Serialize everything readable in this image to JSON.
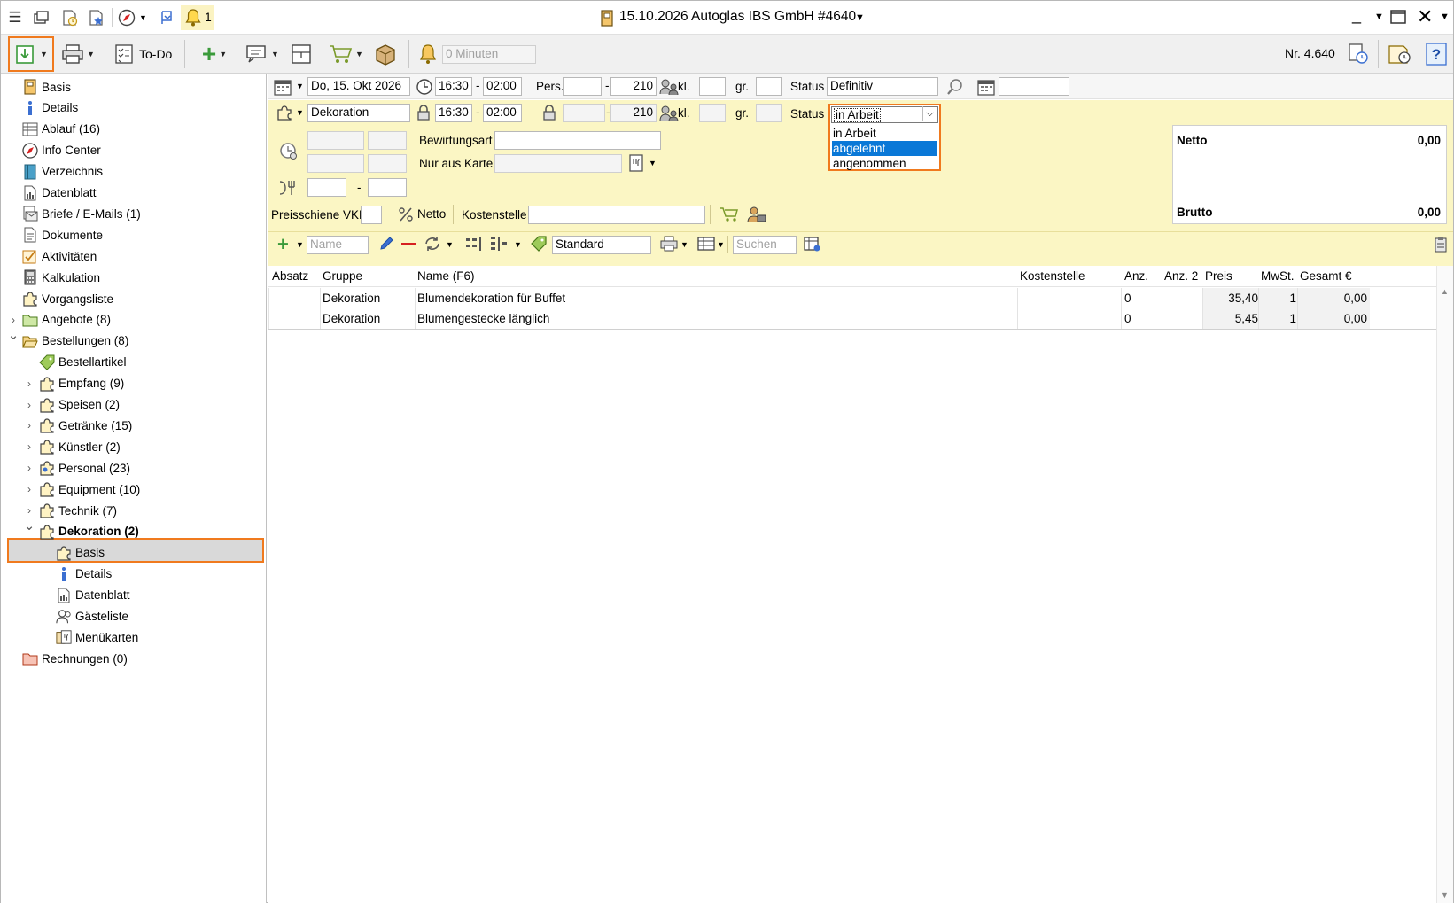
{
  "titlebar": {
    "title": "15.10.2026 Autoglas IBS GmbH  #4640",
    "notification_count": "1"
  },
  "toolbar": {
    "todo_label": "To-Do",
    "minutes_placeholder": "0 Minuten",
    "number": "Nr. 4.640"
  },
  "sidebar": {
    "items": [
      {
        "label": "Basis",
        "icon": "document-icon"
      },
      {
        "label": "Details",
        "icon": "info-icon"
      },
      {
        "label": "Ablauf (16)",
        "icon": "schedule-icon"
      },
      {
        "label": "Info Center",
        "icon": "compass-icon"
      },
      {
        "label": "Verzeichnis",
        "icon": "book-icon"
      },
      {
        "label": "Datenblatt",
        "icon": "datasheet-icon"
      },
      {
        "label": "Briefe / E-Mails (1)",
        "icon": "letter-icon"
      },
      {
        "label": "Dokumente",
        "icon": "documents-icon"
      },
      {
        "label": "Aktivitäten",
        "icon": "checklist-icon"
      },
      {
        "label": "Kalkulation",
        "icon": "calculator-icon"
      },
      {
        "label": "Vorgangsliste",
        "icon": "puzzle-icon"
      },
      {
        "label": "Angebote (8)",
        "icon": "folder-green-icon"
      },
      {
        "label": "Bestellungen (8)",
        "icon": "folder-open-icon"
      },
      {
        "label": "Bestellartikel",
        "icon": "tag-icon"
      },
      {
        "label": "Empfang (9)",
        "icon": "puzzle-icon"
      },
      {
        "label": "Speisen (2)",
        "icon": "puzzle-icon"
      },
      {
        "label": "Getränke (15)",
        "icon": "puzzle-icon"
      },
      {
        "label": "Künstler (2)",
        "icon": "puzzle-icon"
      },
      {
        "label": "Personal (23)",
        "icon": "person-puzzle-icon"
      },
      {
        "label": "Equipment (10)",
        "icon": "puzzle-icon"
      },
      {
        "label": "Technik (7)",
        "icon": "puzzle-icon"
      },
      {
        "label": "Dekoration (2)",
        "icon": "puzzle-icon"
      },
      {
        "label": "Basis",
        "icon": "puzzle-icon"
      },
      {
        "label": "Details",
        "icon": "info-icon"
      },
      {
        "label": "Datenblatt",
        "icon": "datasheet-icon"
      },
      {
        "label": "Gästeliste",
        "icon": "guests-icon"
      },
      {
        "label": "Menükarten",
        "icon": "menu-card-icon"
      },
      {
        "label": "Rechnungen (0)",
        "icon": "folder-red-icon"
      }
    ]
  },
  "event": {
    "date": "Do, 15. Okt 2026",
    "time_from": "16:30",
    "time_to": "02:00",
    "pers_label": "Pers.",
    "pers_to": "210",
    "kl_label": "kl.",
    "gr_label": "gr.",
    "status_label": "Status",
    "status_value": "Definitiv"
  },
  "order": {
    "name": "Dekoration",
    "time_from": "16:30",
    "time_to": "02:00",
    "pers_to": "210",
    "kl_label": "kl.",
    "gr_label": "gr.",
    "status_label": "Status",
    "status_value": "in Arbeit",
    "status_options": [
      "in Arbeit",
      "abgelehnt",
      "angenommen"
    ],
    "status_highlighted": "abgelehnt",
    "bewirtungsart_label": "Bewirtungsart",
    "nur_aus_karte_label": "Nur aus Karte",
    "dash": "-"
  },
  "totals": {
    "netto_label": "Netto",
    "netto_value": "0,00",
    "brutto_label": "Brutto",
    "brutto_value": "0,00"
  },
  "price": {
    "preisschiene_label": "Preisschiene VKN",
    "netto_label": "Netto",
    "kostenstelle_label": "Kostenstelle"
  },
  "grid_toolbar": {
    "name_placeholder": "Name",
    "view_value": "Standard",
    "search_placeholder": "Suchen"
  },
  "grid": {
    "headers": [
      "Absatz",
      "Gruppe",
      "Name (F6)",
      "Kostenstelle",
      "Anz.",
      "Anz. 2",
      "Preis",
      "MwSt.",
      "Gesamt €"
    ],
    "rows": [
      {
        "absatz": "",
        "gruppe": "Dekoration",
        "name": "Blumendekoration für Buffet",
        "kostenstelle": "",
        "anz": "0",
        "anz2": "",
        "preis": "35,40",
        "mwst": "1",
        "gesamt": "0,00"
      },
      {
        "absatz": "",
        "gruppe": "Dekoration",
        "name": "Blumengestecke länglich",
        "kostenstelle": "",
        "anz": "0",
        "anz2": "",
        "preis": "5,45",
        "mwst": "1",
        "gesamt": "0,00"
      }
    ]
  },
  "colors": {
    "accent_orange": "#f07a1e",
    "form_yellow": "#fbf6c4",
    "selection_blue": "#0a78d7"
  }
}
